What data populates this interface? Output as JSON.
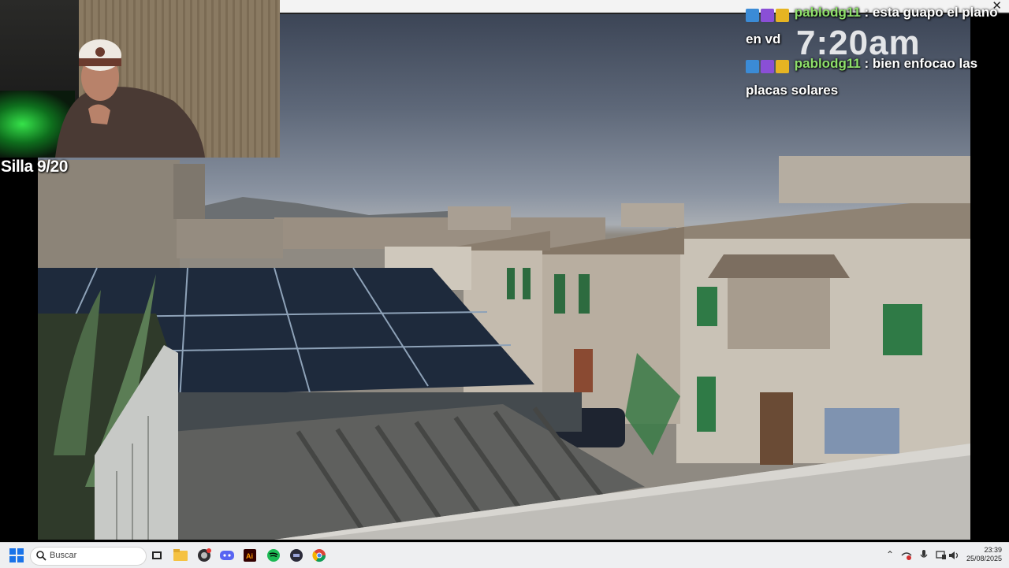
{
  "overlay": {
    "time_text": "7:20am",
    "silla_text": "Silla 9/20"
  },
  "chat": {
    "messages": [
      {
        "user": "pablodg11",
        "separator": " : ",
        "text": "esta guapo el plano en vd"
      },
      {
        "user": "pablodg11",
        "separator": " : ",
        "text": "bien enfocao las placas solares"
      }
    ]
  },
  "taskbar": {
    "search_placeholder": "Buscar",
    "apps": [
      "start-icon",
      "task-view-icon",
      "file-explorer-icon",
      "obs-icon",
      "discord-icon",
      "illustrator-icon",
      "spotify-icon",
      "app-icon",
      "chrome-icon"
    ],
    "clock_time": "23:39",
    "clock_date": "25/08/2025"
  },
  "colors": {
    "username": "#8ee06a",
    "taskbar": "#eeeff1"
  }
}
